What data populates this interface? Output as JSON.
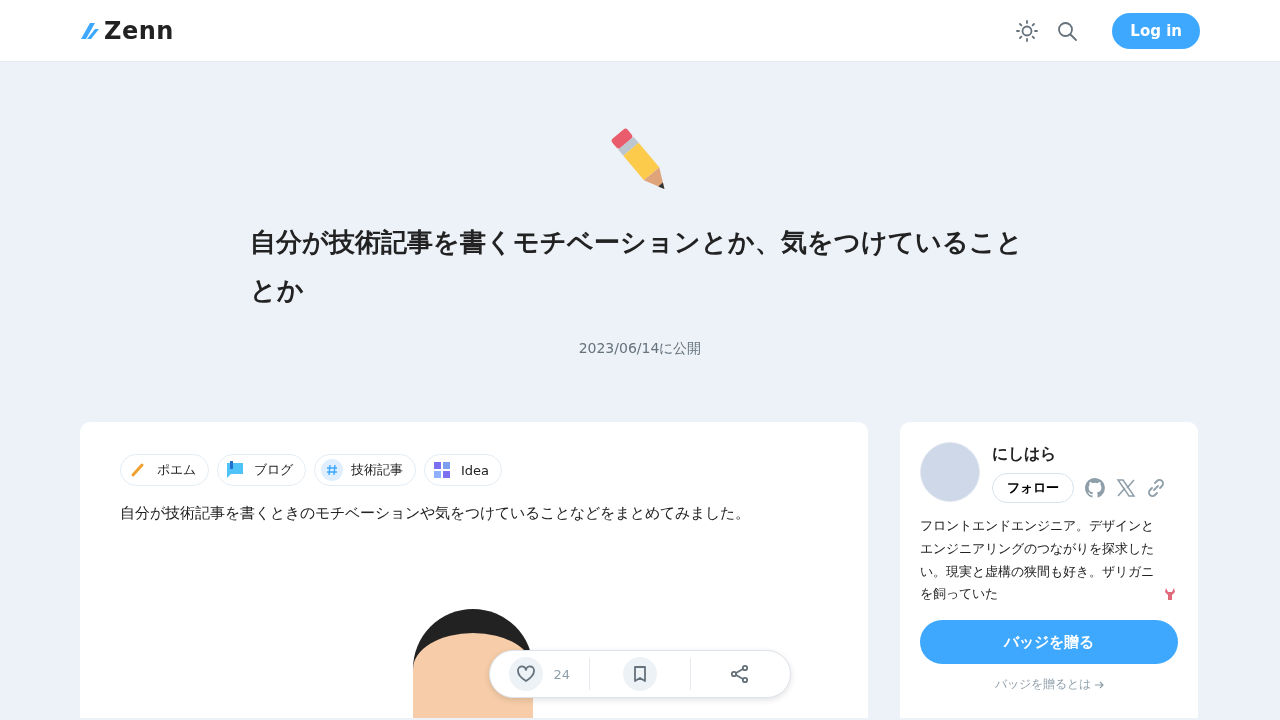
{
  "header": {
    "logo": "Zenn",
    "login": "Log in"
  },
  "article": {
    "title": "自分が技術記事を書くモチベーションとか、気をつけていることとか",
    "date": "2023/06/14に公開",
    "topics": [
      {
        "kind": "pencil",
        "label": "ポエム"
      },
      {
        "kind": "chat",
        "label": "ブログ"
      },
      {
        "kind": "hash",
        "label": "技術記事"
      },
      {
        "kind": "grid",
        "label": "Idea"
      }
    ],
    "summary": "自分が技術記事を書くときのモチベーションや気をつけていることなどをまとめてみました。",
    "likes": "24"
  },
  "author": {
    "name": "にしはら",
    "follow": "フォロー",
    "bio": "フロントエンドエンジニア。デザインとエンジニアリングのつながりを探求したい。現実と虚構の狭間も好き。ザリガニを飼っていた",
    "badge_button": "バッジを贈る",
    "badge_link": "バッジを贈るとは"
  }
}
